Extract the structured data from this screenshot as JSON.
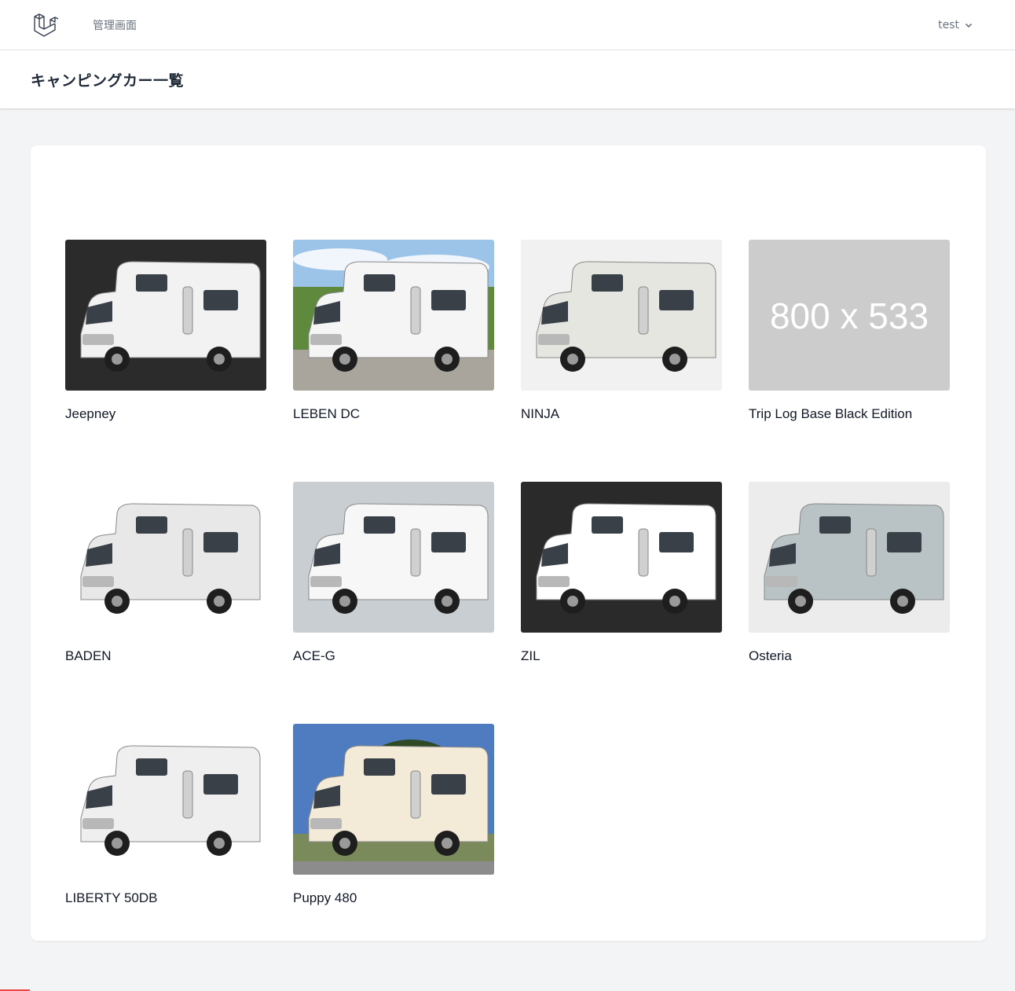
{
  "nav": {
    "admin_link": "管理画面",
    "user_name": "test"
  },
  "header": {
    "title": "キャンピングカー一覧"
  },
  "cars": [
    {
      "name": "Jeepney",
      "bg": "#2b2b2b",
      "body": "#f2f2f2"
    },
    {
      "name": "LEBEN DC",
      "bg": "sky",
      "body": "#f5f5f5"
    },
    {
      "name": "NINJA",
      "bg": "#f1f1f1",
      "body": "#e6e6e0"
    },
    {
      "name": "Trip Log Base Black Edition",
      "bg": "#cccccc",
      "placeholder": "800 x 533"
    },
    {
      "name": "BADEN",
      "bg": "#ffffff",
      "body": "#e8e8e8"
    },
    {
      "name": "ACE-G",
      "bg": "#c9ced3",
      "body": "#f7f7f7"
    },
    {
      "name": "ZIL",
      "bg": "#2a2a2a",
      "body": "#ffffff"
    },
    {
      "name": "Osteria",
      "bg": "#ececec",
      "body": "#b9c2c4"
    },
    {
      "name": "LIBERTY 50DB",
      "bg": "#ffffff",
      "body": "#efefef"
    },
    {
      "name": "Puppy 480",
      "bg": "outdoor",
      "body": "#f3ead8"
    }
  ]
}
